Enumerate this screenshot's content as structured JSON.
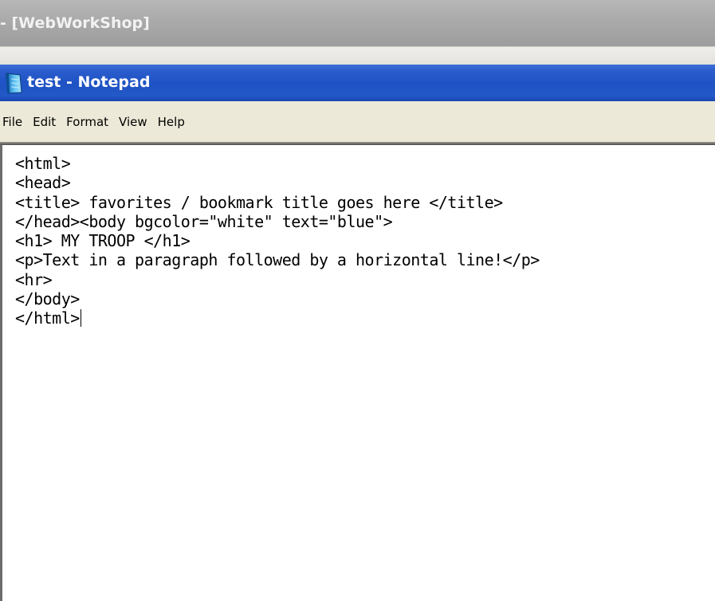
{
  "background_window": {
    "title": "- [WebWorkShop]"
  },
  "notepad": {
    "title": "test - Notepad",
    "icon": "notepad-icon"
  },
  "menu": {
    "items": [
      "File",
      "Edit",
      "Format",
      "View",
      "Help"
    ]
  },
  "editor": {
    "lines": [
      "<html>",
      "<head>",
      "<title> favorites / bookmark title goes here </title>",
      "</head><body bgcolor=\"white\" text=\"blue\">",
      "<h1> MY TROOP </h1>",
      "<p>Text in a paragraph followed by a horizontal line!</p>",
      "<hr>",
      "</body>",
      "</html>"
    ]
  },
  "colors": {
    "titlebar_active": "#2358c8",
    "titlebar_inactive": "#aaaaaa",
    "menubar": "#ece9d8",
    "editor_bg": "#ffffff"
  }
}
